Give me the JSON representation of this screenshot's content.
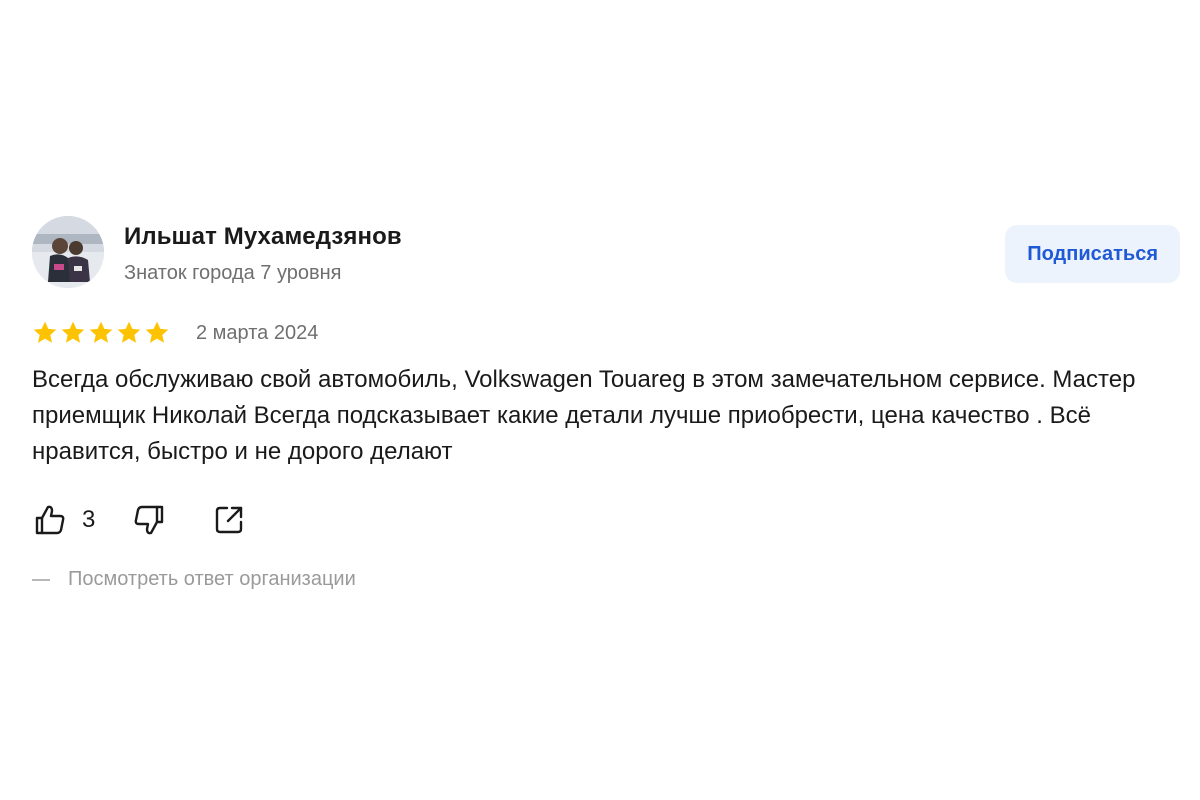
{
  "author": {
    "name": "Ильшат Мухамедзянов",
    "level": "Знаток города 7 уровня"
  },
  "subscribe_label": "Подписаться",
  "rating": {
    "value": 5,
    "max": 5,
    "star_color": "#fdc300"
  },
  "date": "2 марта 2024",
  "text": "Всегда обслуживаю свой автомобиль, Volkswagen Touareg в этом замечательном сервисе. Мастер приемщик Николай Всегда подсказывает какие детали лучше приобрести, цена качество . Всё нравится, быстро и не дорого делают",
  "actions": {
    "like_icon": "thumbs-up-icon",
    "like_count": "3",
    "dislike_icon": "thumbs-down-icon",
    "share_icon": "share-icon"
  },
  "org_reply_label": "Посмотреть ответ организации",
  "colors": {
    "accent": "#1f59d6",
    "button_bg": "#edf3fc",
    "muted_text": "#6f6f6f"
  }
}
